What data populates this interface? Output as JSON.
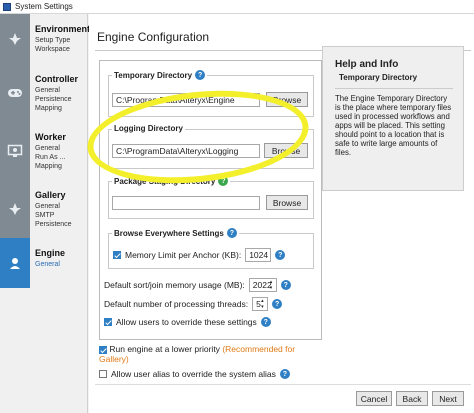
{
  "window": {
    "title": "System Settings",
    "icon": "app-icon"
  },
  "sidebar": {
    "groups": [
      {
        "icon": "leaf-icon",
        "label": "Environment",
        "items": [
          "Setup Type",
          "Workspace"
        ],
        "active": false
      },
      {
        "icon": "gamepad-icon",
        "label": "Controller",
        "items": [
          "General",
          "Persistence",
          "Mapping"
        ],
        "active": false
      },
      {
        "icon": "monitor-icon",
        "label": "Worker",
        "items": [
          "General",
          "Run As ...",
          "Mapping"
        ],
        "active": false
      },
      {
        "icon": "leaf-icon",
        "label": "Gallery",
        "items": [
          "General",
          "SMTP",
          "Persistence"
        ],
        "active": false
      },
      {
        "icon": "engine-icon",
        "label": "Engine",
        "items": [
          "General"
        ],
        "active": true
      }
    ]
  },
  "main": {
    "title": "Engine Configuration",
    "temp_dir": {
      "label": "Temporary Directory",
      "value": "C:\\ProgramData\\Alteryx\\Engine",
      "button": "Browse"
    },
    "log_dir": {
      "label": "Logging Directory",
      "value": "C:\\ProgramData\\Alteryx\\Logging",
      "button": "Browse"
    },
    "pkg_dir": {
      "label": "Package Staging Directory",
      "value": "",
      "button": "Browse"
    },
    "browse_everywhere": {
      "label": "Browse Everywhere Settings",
      "memory_checkbox": true,
      "memory_label": "Memory Limit per Anchor (KB):",
      "memory_value": "1024"
    },
    "sort_join": {
      "label": "Default sort/join memory usage (MB):",
      "value": "2022"
    },
    "threads": {
      "label": "Default number of processing threads:",
      "value": "5"
    },
    "allow_override": {
      "checked": true,
      "label": "Allow users to override these settings"
    },
    "run_lower": {
      "checked": true,
      "label": "Run engine at a lower priority",
      "note": "(Recommended for Gallery)"
    },
    "alias_override": {
      "checked": false,
      "label": "Allow user alias to override the system alias"
    }
  },
  "info": {
    "title": "Help and Info",
    "subtitle": "Temporary Directory",
    "body": "The Engine Temporary Directory is the place where temporary files used in processed workflows and apps will be placed. This setting should point to a location that is safe to write large amounts of files."
  },
  "footer": {
    "cancel": "Cancel",
    "back": "Back",
    "next": "Next"
  },
  "annotation": {
    "highlight_color": "#f3ef2a"
  }
}
